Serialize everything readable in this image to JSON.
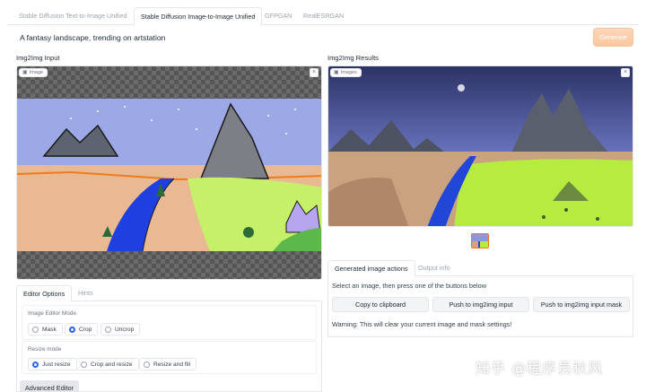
{
  "tabs": [
    {
      "label": "Stable Diffusion Text-to-Image Unified",
      "active": false
    },
    {
      "label": "Stable Diffusion Image-to-Image Unified",
      "active": true
    },
    {
      "label": "GFPGAN",
      "active": false
    },
    {
      "label": "RealESRGAN",
      "active": false
    }
  ],
  "prompt": {
    "value": "A fantasy landscape, trending on artstation"
  },
  "generate_label": "Generate",
  "input_panel": {
    "title": "Img2Img Input",
    "box_label": "Image",
    "close": "×"
  },
  "results_panel": {
    "title": "Img2Img Results",
    "box_label": "Images",
    "close": "×"
  },
  "editor_tabs": [
    {
      "label": "Editor Options",
      "active": true
    },
    {
      "label": "Hints",
      "active": false
    }
  ],
  "editor": {
    "mode_label": "Image Editor Mode",
    "modes": [
      {
        "label": "Mask",
        "selected": false
      },
      {
        "label": "Crop",
        "selected": true
      },
      {
        "label": "Uncrop",
        "selected": false
      }
    ],
    "resize_label": "Resize mode",
    "resize_modes": [
      {
        "label": "Just resize",
        "selected": true
      },
      {
        "label": "Crop and resize",
        "selected": false
      },
      {
        "label": "Resize and fill",
        "selected": false
      }
    ],
    "advanced_label": "Advanced Editor"
  },
  "action_tabs": [
    {
      "label": "Generated image actions",
      "active": true
    },
    {
      "label": "Output info",
      "active": false
    }
  ],
  "actions": {
    "instruction": "Select an image, then press one of the buttons below",
    "buttons": [
      "Copy to clipboard",
      "Push to img2img input",
      "Push to img2img input mask"
    ],
    "warning": "Warning: This will clear your current image and mask settings!"
  },
  "watermark": "知乎 @程序员秋风",
  "colors": {
    "accent": "#f97316",
    "generate": "#f9c7a0",
    "radio_selected": "#2563eb"
  }
}
